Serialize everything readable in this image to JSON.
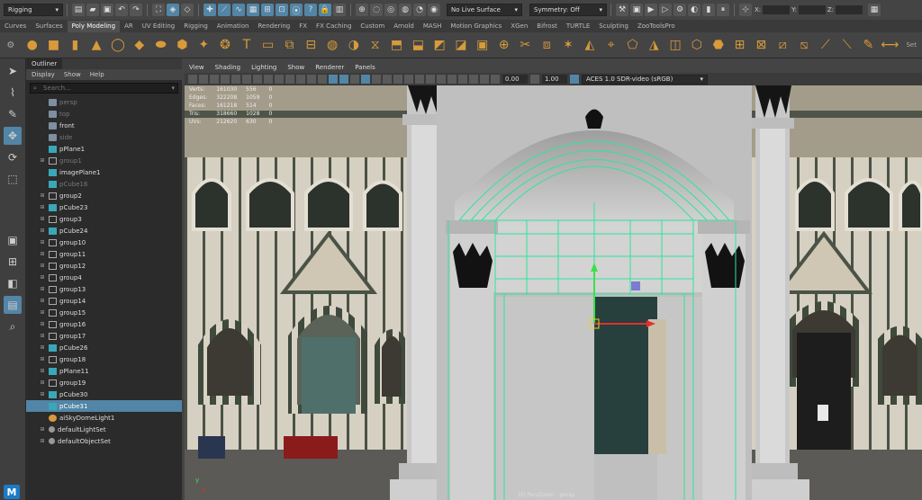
{
  "status_line": {
    "mode_menu": "Rigging",
    "live_surface": "No Live Surface",
    "symmetry": "Symmetry: Off",
    "x_label": "X:",
    "y_label": "Y:",
    "z_label": "Z:"
  },
  "shelf_tabs": [
    "Curves",
    "Surfaces",
    "Poly Modeling",
    "AR",
    "UV Editing",
    "Rigging",
    "Animation",
    "Rendering",
    "FX",
    "FX Caching",
    "Custom",
    "Arnold",
    "MASH",
    "Motion Graphics",
    "XGen",
    "Bifrost",
    "TURTLE",
    "Sculpting",
    "ZooToolsPro"
  ],
  "active_shelf_tab": "Poly Modeling",
  "shelf_set_label": "Set",
  "outliner": {
    "title": "Outliner",
    "menu": [
      "Display",
      "Show",
      "Help"
    ],
    "search_placeholder": "Search...",
    "items": [
      {
        "label": "persp",
        "icon": "camera-icon",
        "dim": true,
        "expandable": false
      },
      {
        "label": "top",
        "icon": "camera-icon",
        "dim": true,
        "expandable": false
      },
      {
        "label": "front",
        "icon": "camera-icon",
        "dim": false,
        "expandable": false
      },
      {
        "label": "side",
        "icon": "camera-icon",
        "dim": true,
        "expandable": false
      },
      {
        "label": "pPlane1",
        "icon": "mesh-icon",
        "dim": false,
        "expandable": false
      },
      {
        "label": "group1",
        "icon": "group-icon",
        "dim": true,
        "expandable": true
      },
      {
        "label": "imagePlane1",
        "icon": "mesh-icon",
        "dim": false,
        "expandable": false
      },
      {
        "label": "pCube16",
        "icon": "mesh-icon",
        "dim": true,
        "expandable": false
      },
      {
        "label": "group2",
        "icon": "group-icon",
        "dim": false,
        "expandable": true
      },
      {
        "label": "pCube23",
        "icon": "mesh-icon",
        "dim": false,
        "expandable": true
      },
      {
        "label": "group3",
        "icon": "group-icon",
        "dim": false,
        "expandable": true
      },
      {
        "label": "pCube24",
        "icon": "mesh-icon",
        "dim": false,
        "expandable": true
      },
      {
        "label": "group10",
        "icon": "group-icon",
        "dim": false,
        "expandable": true
      },
      {
        "label": "group11",
        "icon": "group-icon",
        "dim": false,
        "expandable": true
      },
      {
        "label": "group12",
        "icon": "group-icon",
        "dim": false,
        "expandable": true
      },
      {
        "label": "group4",
        "icon": "group-icon",
        "dim": false,
        "expandable": true
      },
      {
        "label": "group13",
        "icon": "group-icon",
        "dim": false,
        "expandable": true
      },
      {
        "label": "group14",
        "icon": "group-icon",
        "dim": false,
        "expandable": true
      },
      {
        "label": "group15",
        "icon": "group-icon",
        "dim": false,
        "expandable": true
      },
      {
        "label": "group16",
        "icon": "group-icon",
        "dim": false,
        "expandable": true
      },
      {
        "label": "group17",
        "icon": "group-icon",
        "dim": false,
        "expandable": true
      },
      {
        "label": "pCube26",
        "icon": "mesh-icon",
        "dim": false,
        "expandable": true
      },
      {
        "label": "group18",
        "icon": "group-icon",
        "dim": false,
        "expandable": true
      },
      {
        "label": "pPlane11",
        "icon": "mesh-icon",
        "dim": false,
        "expandable": true
      },
      {
        "label": "group19",
        "icon": "group-icon",
        "dim": false,
        "expandable": true
      },
      {
        "label": "pCube30",
        "icon": "mesh-icon",
        "dim": false,
        "expandable": true
      },
      {
        "label": "pCube31",
        "icon": "mesh-icon",
        "dim": false,
        "expandable": false,
        "selected": true
      },
      {
        "label": "aiSkyDomeLight1",
        "icon": "light-icon",
        "dim": false,
        "expandable": false
      },
      {
        "label": "defaultLightSet",
        "icon": "set-icon",
        "dim": false,
        "expandable": true
      },
      {
        "label": "defaultObjectSet",
        "icon": "set-icon",
        "dim": false,
        "expandable": true
      }
    ]
  },
  "viewport": {
    "menu": [
      "View",
      "Shading",
      "Lighting",
      "Show",
      "Renderer",
      "Panels"
    ],
    "field_1": "0.00",
    "field_2": "1.00",
    "color_space": "ACES 1.0 SDR-video (sRGB)",
    "hud_rows": [
      {
        "label": "Verts:",
        "a": "161030",
        "b": "556",
        "c": "0"
      },
      {
        "label": "Edges:",
        "a": "322208",
        "b": "1059",
        "c": "0"
      },
      {
        "label": "Faces:",
        "a": "161218",
        "b": "514",
        "c": "0"
      },
      {
        "label": "Tris:",
        "a": "318660",
        "b": "1028",
        "c": "0"
      },
      {
        "label": "UVs:",
        "a": "212620",
        "b": "630",
        "c": "0"
      }
    ],
    "camera_label": "2D Pan/Zoom : persp",
    "axis_x": "x",
    "axis_y": "y"
  },
  "colors": {
    "accent": "#5285a6",
    "wireframe": "#2ee59a",
    "manip_y": "#3ee04a",
    "manip_x": "#e03030",
    "shelf_icon": "#d89a3a"
  },
  "maya_logo": "M"
}
